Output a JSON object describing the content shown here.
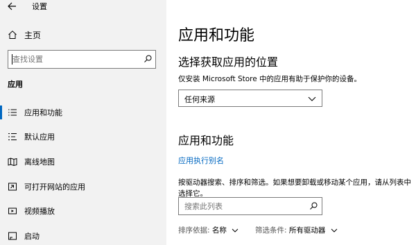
{
  "window": {
    "title": "设置"
  },
  "sidebar": {
    "home_label": "主页",
    "search_placeholder": "查找设置",
    "section_label": "应用",
    "items": [
      {
        "label": "应用和功能",
        "icon": "list-icon",
        "active": true
      },
      {
        "label": "默认应用",
        "icon": "default-apps-icon",
        "active": false
      },
      {
        "label": "离线地图",
        "icon": "map-icon",
        "active": false
      },
      {
        "label": "可打开网站的应用",
        "icon": "open-in-app-icon",
        "active": false
      },
      {
        "label": "视频播放",
        "icon": "video-icon",
        "active": false
      },
      {
        "label": "启动",
        "icon": "startup-icon",
        "active": false
      }
    ]
  },
  "main": {
    "title": "应用和功能",
    "source_section": {
      "heading": "选择获取应用的位置",
      "description": "仅安装 Microsoft Store 中的应用有助于保护你的设备。",
      "dropdown_value": "任何来源"
    },
    "apps_section": {
      "heading": "应用和功能",
      "alias_link": "应用执行别名",
      "description": "按驱动器搜索、排序和筛选。如果想要卸载或移动某个应用，请从列表中选择它。",
      "search_placeholder": "搜索此列表",
      "sort_label": "排序依据:",
      "sort_value": "名称",
      "filter_label": "筛选条件:",
      "filter_value": "所有驱动器"
    }
  },
  "colors": {
    "accent": "#0067c0",
    "sidebar_bg": "#f2f2f2"
  }
}
